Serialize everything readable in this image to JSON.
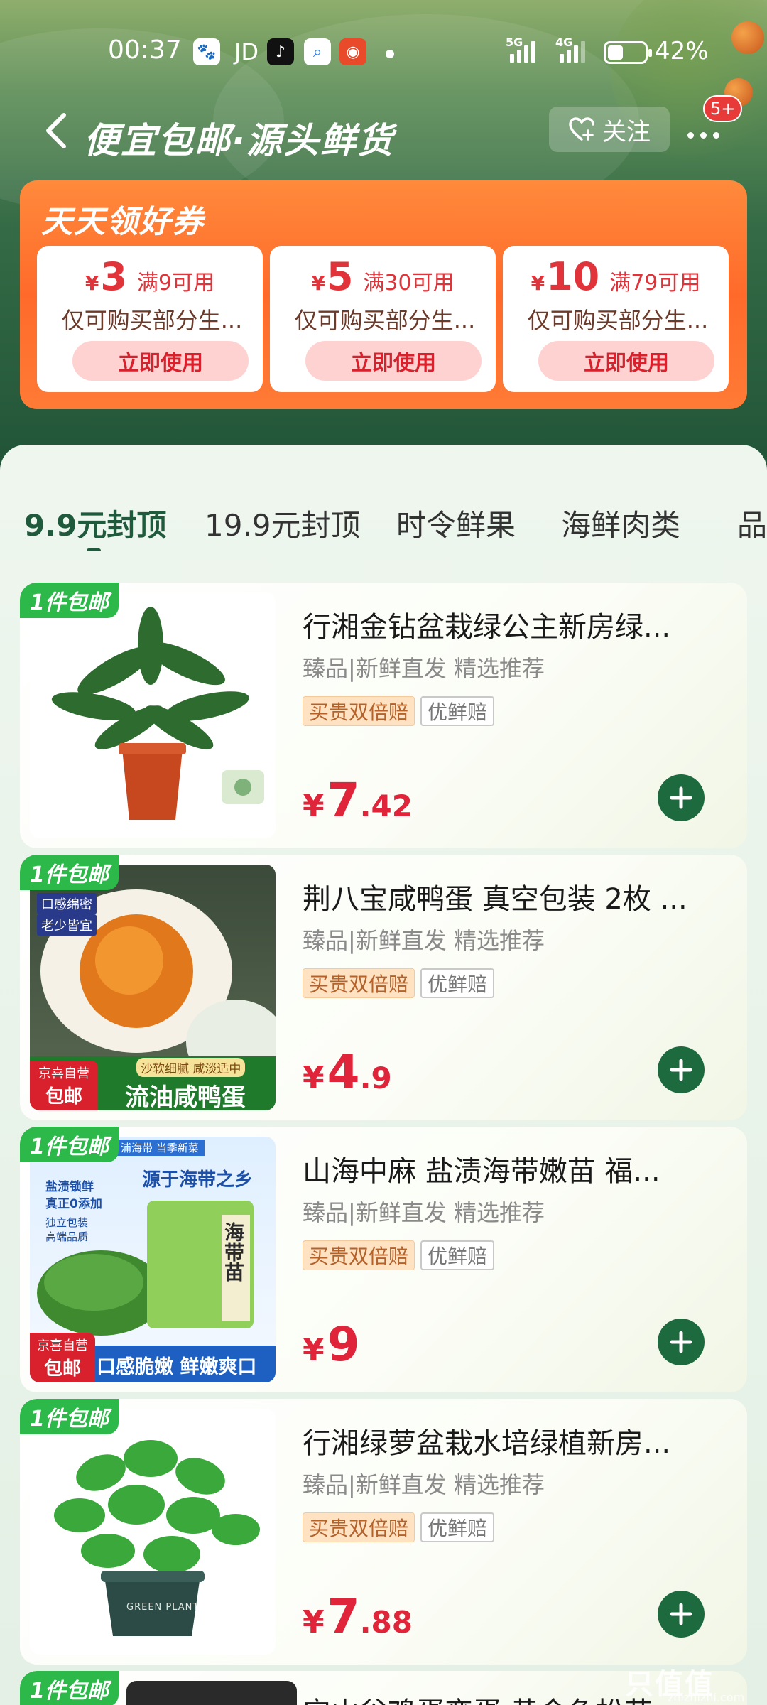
{
  "status_bar": {
    "time": "00:37",
    "app_icons": [
      "baidu-icon",
      "jd-icon",
      "douyin-icon",
      "search-app-icon",
      "taobao-icon"
    ],
    "jd_label": "JD",
    "network_5g": "5G",
    "network_4g": "4G",
    "battery_percent_text": "42%",
    "battery_level": 0.42
  },
  "header": {
    "title": "便宜包邮·源头鲜货",
    "follow_label": "关注",
    "badge": "5+"
  },
  "coupons": {
    "title": "天天领好券",
    "items": [
      {
        "yen": "¥",
        "amount": "3",
        "condition": "满9可用",
        "desc": "仅可购买部分生...",
        "button": "立即使用"
      },
      {
        "yen": "¥",
        "amount": "5",
        "condition": "满30可用",
        "desc": "仅可购买部分生...",
        "button": "立即使用"
      },
      {
        "yen": "¥",
        "amount": "10",
        "condition": "满79可用",
        "desc": "仅可购买部分生...",
        "button": "立即使用"
      }
    ]
  },
  "tabs": [
    "9.9元封顶",
    "19.9元封顶",
    "时令鲜果",
    "海鲜肉类",
    "品"
  ],
  "active_tab": "9.9元封顶",
  "products": [
    {
      "ship_tag": "1件包邮",
      "name": "行湘金钻盆栽绿公主新房绿...",
      "sub": "臻品|新鲜直发 精选推荐",
      "chip1": "买贵双倍赔",
      "chip2": "优鲜赔",
      "yen": "¥",
      "price_int": "7",
      "price_dec": ".42"
    },
    {
      "ship_tag": "1件包邮",
      "name": "荆八宝咸鸭蛋 真空包装 2枚 ...",
      "sub": "臻品|新鲜直发 精选推荐",
      "chip1": "买贵双倍赔",
      "chip2": "优鲜赔",
      "yen": "¥",
      "price_int": "4",
      "price_dec": ".9",
      "image_text": {
        "tl1": "口感绵密",
        "tl2": "老少皆宜",
        "banner_small": "沙软细腻 咸淡适中",
        "banner": "流油咸鸭蛋",
        "self1": "京喜自营",
        "self2": "包邮"
      }
    },
    {
      "ship_tag": "1件包邮",
      "name": "山海中麻 盐渍海带嫩苗 福...",
      "sub": "臻品|新鲜直发 精选推荐",
      "chip1": "买贵双倍赔",
      "chip2": "优鲜赔",
      "yen": "¥",
      "price_int": "9",
      "price_dec": "",
      "image_text": {
        "top": "浦海带  当季新菜",
        "headline": "源于海带之乡",
        "left1": "盐渍锁鲜",
        "left2": "真正0添加",
        "left3": "独立包装",
        "left4": "高端品质",
        "pack": "海带苗",
        "banner": "口感脆嫩 鲜嫩爽口",
        "self1": "京喜自营",
        "self2": "包邮"
      }
    },
    {
      "ship_tag": "1件包邮",
      "name": "行湘绿萝盆栽水培绿植新房...",
      "sub": "臻品|新鲜直发 精选推荐",
      "chip1": "买贵双倍赔",
      "chip2": "优鲜赔",
      "yen": "¥",
      "price_int": "7",
      "price_dec": ".88",
      "image_text": {
        "pot": "GREEN PLANT"
      }
    },
    {
      "ship_tag": "1件包邮",
      "name": "宁山谷鸡蛋变蛋 黄金色松花"
    }
  ],
  "watermark": "只值值",
  "watermark_sub": "zhizhizhi.com",
  "colors": {
    "accent_green": "#1d6a3e",
    "price_red": "#e0243a",
    "coupon_orange": "#ff6a2a",
    "ship_tag_green": "#2db84a"
  }
}
